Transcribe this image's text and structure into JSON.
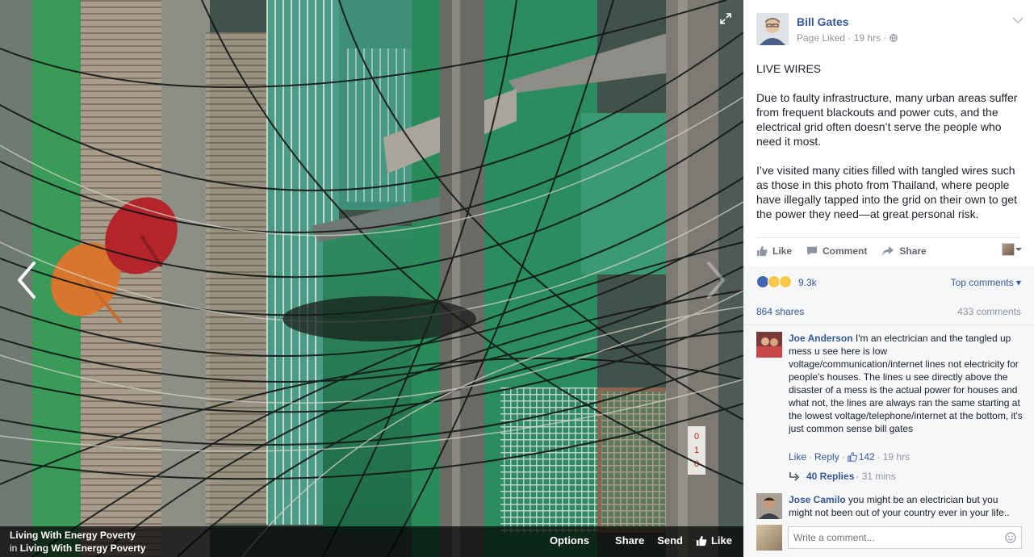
{
  "photo": {
    "prev_label": "Previous",
    "next_label": "Next",
    "album_title": "Living With Energy Poverty",
    "album_in": "in",
    "album_name": "Living With Energy Poverty",
    "sign_text": "010",
    "actions": {
      "options": "Options",
      "share": "Share",
      "send": "Send",
      "like": "Like"
    }
  },
  "post": {
    "author": "Bill Gates",
    "meta": "Page Liked · 19 hrs · ",
    "heading": "LIVE WIRES",
    "paragraph1": "Due to faulty infrastructure, many urban areas suffer from frequent blackouts and power cuts, and the electrical grid often doesn’t serve the people who need it most.",
    "paragraph2": "I’ve visited many cities filled with tangled wires such as those in this photo from Thailand, where people have illegally tapped into the grid on their own to get the power they need—at great personal risk.",
    "actions": {
      "like": "Like",
      "comment": "Comment",
      "share": "Share"
    }
  },
  "stats": {
    "reaction_count": "9.3k",
    "top_comments": "Top comments ▾",
    "shares": "864 shares",
    "comments": "433 comments"
  },
  "comments": [
    {
      "name": "Joe Anderson",
      "text": " I'm an electrician and the tangled up mess u see here is low voltage/communication/internet lines not electricity for people's houses. The lines u see directly above the disaster of a mess is the actual power for houses and what not, the lines are always ran the same starting at the lowest voltage/telephone/internet at the bottom, it's just common sense bill gates",
      "like": "Like",
      "reply": "Reply",
      "likes": "142",
      "time": "19 hrs",
      "replies": "40 Replies",
      "replies_time": "· 31 mins"
    },
    {
      "name": "Jose Camilo",
      "text": " you might be an electrician but you might not been out of your country ever in your life.."
    }
  ],
  "composer": {
    "placeholder": "Write a comment..."
  },
  "colors": {
    "link": "#365899",
    "meta": "#90949c",
    "like_blue": "#4267b2"
  },
  "icons": [
    "expand-icon",
    "chevron-left-icon",
    "chevron-right-icon",
    "globe-icon",
    "chevron-down-icon",
    "like-thumb-icon",
    "comment-icon",
    "share-arrow-icon",
    "reply-arrow-icon",
    "emoji-icon"
  ]
}
